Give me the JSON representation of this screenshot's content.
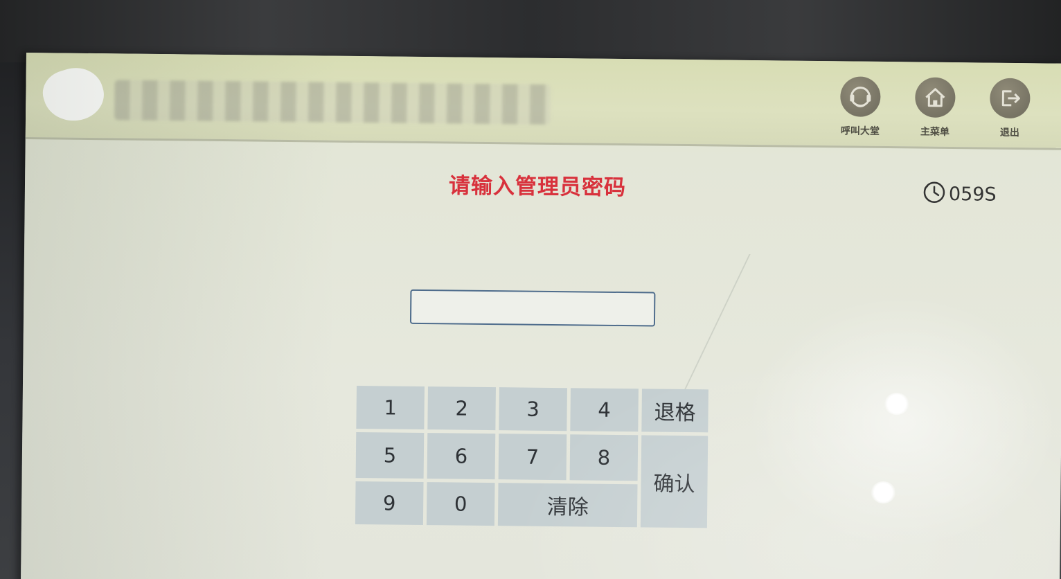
{
  "header": {
    "buttons": [
      {
        "label": "呼叫大堂",
        "icon": "headset-icon"
      },
      {
        "label": "主菜单",
        "icon": "home-icon"
      },
      {
        "label": "退出",
        "icon": "exit-icon"
      }
    ]
  },
  "main": {
    "title": "请输入管理员密码",
    "timer": "059S",
    "password_value": ""
  },
  "keypad": {
    "digits": [
      "1",
      "2",
      "3",
      "4",
      "5",
      "6",
      "7",
      "8",
      "9",
      "0"
    ],
    "backspace_label": "退格",
    "confirm_label": "确认",
    "clear_label": "清除"
  },
  "colors": {
    "title_red": "#d8313c",
    "key_bg": "#c5cfd1",
    "header_bg": "#d8ddb4",
    "input_border": "#4e6c8c"
  }
}
